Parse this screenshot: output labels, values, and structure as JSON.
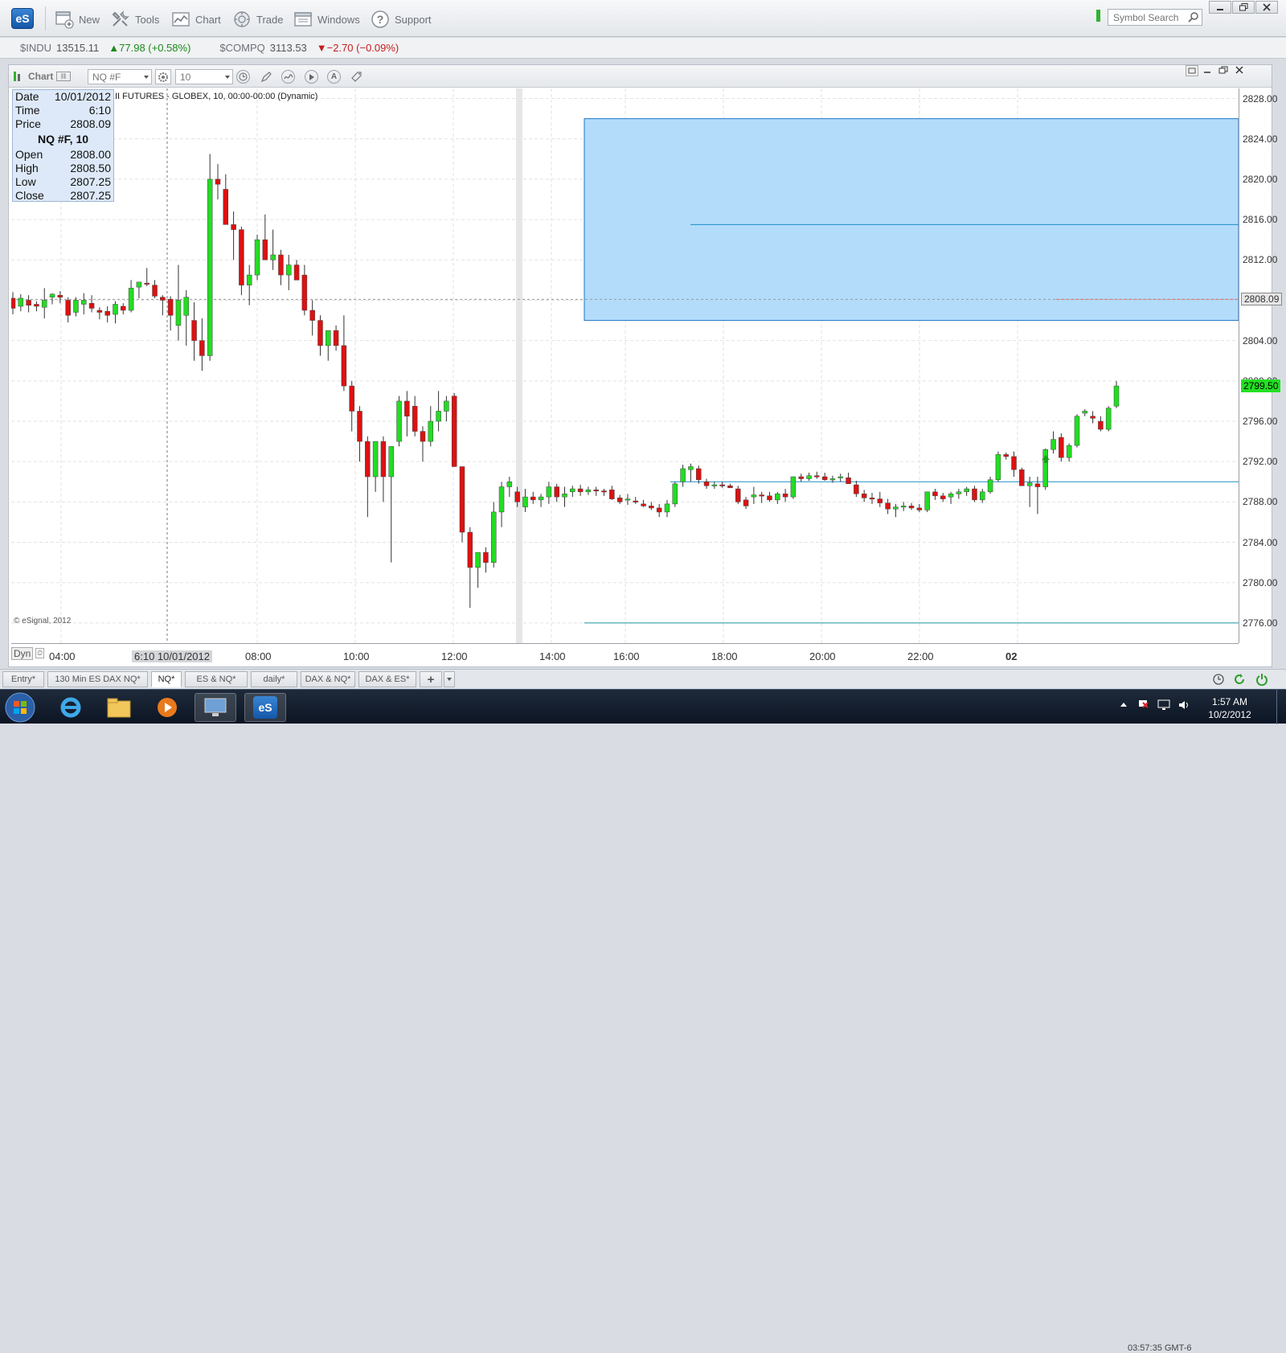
{
  "toolbar": {
    "logo": "eS",
    "buttons": [
      {
        "label": "New"
      },
      {
        "label": "Tools"
      },
      {
        "label": "Chart"
      },
      {
        "label": "Trade"
      },
      {
        "label": "Windows"
      },
      {
        "label": "Support"
      }
    ],
    "search_placeholder": "Symbol Search"
  },
  "tickers": [
    {
      "symbol": "$INDU",
      "value": "13515.11",
      "change": "▲77.98 (+0.58%)",
      "dir": "up"
    },
    {
      "symbol": "$COMPQ",
      "value": "3113.53",
      "change": "▼−2.70 (−0.09%)",
      "dir": "down"
    }
  ],
  "chart_window": {
    "title": "Chart",
    "symbol": "NQ #F",
    "interval": "10",
    "series_title": "II FUTURES - GLOBEX, 10, 00:00-00:00 (Dynamic)",
    "copyright": "© eSignal, 2012",
    "dyn_label": "Dyn"
  },
  "data_box": {
    "date_label": "Date",
    "date": "10/01/2012",
    "time_label": "Time",
    "time": "6:10",
    "price_label": "Price",
    "price": "2808.09",
    "header": "NQ #F, 10",
    "open_label": "Open",
    "open": "2808.00",
    "high_label": "High",
    "high": "2808.50",
    "low_label": "Low",
    "low": "2807.25",
    "close_label": "Close",
    "close": "2807.25"
  },
  "price_axis": {
    "labels": [
      "2828.00",
      "2824.00",
      "2820.00",
      "2816.00",
      "2812.00",
      "2808.09",
      "2804.00",
      "2800.00",
      "2796.00",
      "2792.00",
      "2788.00",
      "2784.00",
      "2780.00",
      "2776.00"
    ],
    "current_price": "2799.50",
    "cursor_price": "2808.09"
  },
  "time_axis": {
    "cursor_label": "6:10 10/01/2012",
    "labels": [
      "04:00",
      "08:00",
      "10:00",
      "12:00",
      "14:00",
      "16:00",
      "18:00",
      "20:00",
      "22:00",
      "02"
    ]
  },
  "tabs": [
    {
      "label": "Entry*"
    },
    {
      "label": "130 Min ES DAX NQ*"
    },
    {
      "label": "NQ*"
    },
    {
      "label": "ES & NQ*"
    },
    {
      "label": "daily*"
    },
    {
      "label": "DAX & NQ*"
    },
    {
      "label": "DAX & ES*"
    },
    {
      "label": "+"
    }
  ],
  "status": {
    "clock": "03:57:35 GMT-6"
  },
  "taskbar": {
    "time": "1:57 AM",
    "date": "10/2/2012"
  },
  "colors": {
    "up": "#22dd22",
    "down": "#dd1111",
    "zone": "#b3dcfb",
    "zone_border": "#1f78c8",
    "level_line": "#1a8fc9"
  },
  "chart_data": {
    "type": "candlestick",
    "symbol": "NQ #F",
    "interval_minutes": 10,
    "ylim": [
      2774,
      2829
    ],
    "y_ticks": [
      2776,
      2780,
      2784,
      2788,
      2792,
      2796,
      2800,
      2804,
      2808,
      2812,
      2816,
      2820,
      2824,
      2828
    ],
    "x_ticks": [
      "04:00",
      "08:00",
      "10:00",
      "12:00",
      "14:00",
      "16:00",
      "18:00",
      "20:00",
      "22:00",
      "02"
    ],
    "candles": [
      [
        2808.2,
        2808.8,
        2806.6,
        2807.2
      ],
      [
        2807.4,
        2808.6,
        2806.9,
        2808.2
      ],
      [
        2808.0,
        2808.5,
        2806.8,
        2807.5
      ],
      [
        2807.6,
        2807.9,
        2806.9,
        2807.4
      ],
      [
        2807.3,
        2809.2,
        2806.2,
        2808.0
      ],
      [
        2808.3,
        2808.7,
        2807.6,
        2808.6
      ],
      [
        2808.5,
        2808.9,
        2807.7,
        2808.3
      ],
      [
        2808.0,
        2808.3,
        2805.8,
        2806.5
      ],
      [
        2806.8,
        2808.3,
        2806.4,
        2808.0
      ],
      [
        2807.6,
        2808.7,
        2806.6,
        2808.0
      ],
      [
        2807.7,
        2808.5,
        2806.8,
        2807.2
      ],
      [
        2807.0,
        2807.3,
        2806.1,
        2806.8
      ],
      [
        2806.9,
        2807.4,
        2805.8,
        2806.5
      ],
      [
        2806.6,
        2807.9,
        2805.7,
        2807.6
      ],
      [
        2807.4,
        2807.7,
        2806.6,
        2807.0
      ],
      [
        2807.0,
        2810.0,
        2806.8,
        2809.2
      ],
      [
        2809.3,
        2809.8,
        2808.2,
        2809.8
      ],
      [
        2809.7,
        2811.2,
        2809.4,
        2809.6
      ],
      [
        2809.5,
        2810.0,
        2808.2,
        2808.4
      ],
      [
        2808.3,
        2808.5,
        2806.5,
        2808.0
      ],
      [
        2808.1,
        2808.4,
        2805.0,
        2806.5
      ],
      [
        2805.5,
        2811.5,
        2804.0,
        2808.0
      ],
      [
        2806.5,
        2809.0,
        2803.5,
        2808.3
      ],
      [
        2806.0,
        2807.8,
        2802.0,
        2804.0
      ],
      [
        2804.0,
        2806.2,
        2801.0,
        2802.5
      ],
      [
        2802.5,
        2822.5,
        2802.0,
        2820.0
      ],
      [
        2820.0,
        2821.5,
        2818.0,
        2819.5
      ],
      [
        2819.0,
        2820.5,
        2815.5,
        2815.5
      ],
      [
        2815.5,
        2816.8,
        2812.0,
        2815.0
      ],
      [
        2815.0,
        2815.3,
        2808.5,
        2809.5
      ],
      [
        2809.5,
        2811.5,
        2807.5,
        2810.5
      ],
      [
        2810.5,
        2814.5,
        2810.0,
        2814.0
      ],
      [
        2814.0,
        2816.5,
        2812.0,
        2812.0
      ],
      [
        2812.0,
        2815.0,
        2811.0,
        2812.5
      ],
      [
        2812.5,
        2813.0,
        2809.5,
        2810.5
      ],
      [
        2810.5,
        2812.5,
        2809.0,
        2811.5
      ],
      [
        2811.5,
        2812.0,
        2810.0,
        2810.0
      ],
      [
        2810.5,
        2811.5,
        2806.5,
        2807.0
      ],
      [
        2807.0,
        2808.0,
        2804.5,
        2806.0
      ],
      [
        2806.0,
        2806.5,
        2802.5,
        2803.5
      ],
      [
        2803.5,
        2805.0,
        2802.0,
        2805.0
      ],
      [
        2805.0,
        2805.5,
        2803.0,
        2803.5
      ],
      [
        2803.5,
        2806.5,
        2799.0,
        2799.5
      ],
      [
        2799.5,
        2800.0,
        2795.0,
        2797.0
      ],
      [
        2797.0,
        2797.5,
        2792.0,
        2794.0
      ],
      [
        2794.0,
        2794.5,
        2786.5,
        2790.5
      ],
      [
        2790.5,
        2794.0,
        2789.0,
        2794.0
      ],
      [
        2794.0,
        2794.5,
        2788.0,
        2790.5
      ],
      [
        2790.5,
        2793.5,
        2782.0,
        2793.5
      ],
      [
        2794.0,
        2798.5,
        2793.5,
        2798.0
      ],
      [
        2798.0,
        2799.0,
        2794.5,
        2796.5
      ],
      [
        2797.5,
        2798.5,
        2794.5,
        2795.0
      ],
      [
        2795.0,
        2795.5,
        2792.0,
        2794.0
      ],
      [
        2794.0,
        2797.5,
        2793.5,
        2796.0
      ],
      [
        2796.0,
        2799.0,
        2795.0,
        2797.0
      ],
      [
        2797.0,
        2798.5,
        2796.0,
        2798.0
      ],
      [
        2798.5,
        2798.8,
        2791.5,
        2791.5
      ],
      [
        2791.5,
        2791.5,
        2784.0,
        2785.0
      ],
      [
        2785.0,
        2785.5,
        2777.5,
        2781.5
      ],
      [
        2781.5,
        2782.0,
        2779.5,
        2783.0
      ],
      [
        2783.0,
        2783.5,
        2781.0,
        2782.0
      ],
      [
        2782.0,
        2788.0,
        2781.5,
        2787.0
      ],
      [
        2787.0,
        2790.0,
        2785.5,
        2789.5
      ],
      [
        2789.5,
        2790.5,
        2788.5,
        2790.0
      ],
      [
        2789.0,
        2789.5,
        2787.5,
        2788.0
      ],
      [
        2787.5,
        2789.3,
        2787.0,
        2788.5
      ],
      [
        2788.5,
        2789.0,
        2787.8,
        2788.2
      ],
      [
        2788.2,
        2788.8,
        2787.5,
        2788.5
      ],
      [
        2788.5,
        2790.0,
        2787.8,
        2789.5
      ],
      [
        2789.5,
        2789.8,
        2788.0,
        2788.5
      ],
      [
        2788.5,
        2789.5,
        2787.5,
        2788.8
      ],
      [
        2789.0,
        2789.6,
        2788.5,
        2789.3
      ],
      [
        2789.3,
        2789.7,
        2788.6,
        2789.0
      ],
      [
        2789.0,
        2789.5,
        2788.7,
        2789.2
      ],
      [
        2789.2,
        2789.5,
        2788.6,
        2789.1
      ],
      [
        2789.1,
        2789.3,
        2788.6,
        2789.0
      ],
      [
        2789.2,
        2789.6,
        2788.2,
        2788.3
      ],
      [
        2788.4,
        2788.7,
        2787.8,
        2788.0
      ],
      [
        2788.2,
        2788.8,
        2787.7,
        2788.3
      ],
      [
        2788.1,
        2788.5,
        2787.8,
        2788.0
      ],
      [
        2787.8,
        2788.2,
        2787.5,
        2787.6
      ],
      [
        2787.6,
        2788.0,
        2787.2,
        2787.4
      ],
      [
        2787.4,
        2787.8,
        2786.5,
        2787.0
      ],
      [
        2787.0,
        2788.2,
        2786.5,
        2787.8
      ],
      [
        2787.8,
        2790.0,
        2787.5,
        2789.8
      ],
      [
        2790.0,
        2791.7,
        2789.5,
        2791.3
      ],
      [
        2791.2,
        2791.8,
        2790.0,
        2791.5
      ],
      [
        2791.3,
        2791.6,
        2789.8,
        2790.2
      ],
      [
        2790.0,
        2790.3,
        2789.3,
        2789.6
      ],
      [
        2789.6,
        2790.0,
        2789.3,
        2789.7
      ],
      [
        2789.7,
        2790.0,
        2789.4,
        2789.6
      ],
      [
        2789.6,
        2789.8,
        2789.4,
        2789.4
      ],
      [
        2789.3,
        2789.6,
        2787.8,
        2788.0
      ],
      [
        2788.2,
        2788.5,
        2787.3,
        2787.6
      ],
      [
        2788.5,
        2789.5,
        2787.8,
        2788.7
      ],
      [
        2788.7,
        2789.0,
        2787.9,
        2788.6
      ],
      [
        2788.6,
        2789.0,
        2788.0,
        2788.2
      ],
      [
        2788.2,
        2789.0,
        2787.8,
        2788.8
      ],
      [
        2788.8,
        2789.3,
        2788.0,
        2788.5
      ],
      [
        2788.5,
        2790.5,
        2788.3,
        2790.5
      ],
      [
        2790.5,
        2790.8,
        2790.0,
        2790.3
      ],
      [
        2790.3,
        2790.9,
        2790.1,
        2790.6
      ],
      [
        2790.6,
        2791.0,
        2790.3,
        2790.5
      ],
      [
        2790.5,
        2790.9,
        2790.1,
        2790.2
      ],
      [
        2790.2,
        2790.6,
        2789.9,
        2790.3
      ],
      [
        2790.5,
        2790.8,
        2790.0,
        2790.5
      ],
      [
        2790.4,
        2790.9,
        2789.8,
        2789.8
      ],
      [
        2789.7,
        2790.1,
        2788.5,
        2788.8
      ],
      [
        2788.8,
        2789.2,
        2788.0,
        2788.4
      ],
      [
        2788.4,
        2788.9,
        2787.8,
        2788.3
      ],
      [
        2788.3,
        2789.0,
        2787.5,
        2787.9
      ],
      [
        2787.9,
        2788.3,
        2786.8,
        2787.3
      ],
      [
        2787.3,
        2787.8,
        2786.5,
        2787.5
      ],
      [
        2787.5,
        2788.0,
        2787.1,
        2787.6
      ],
      [
        2787.6,
        2787.9,
        2787.2,
        2787.4
      ],
      [
        2787.4,
        2787.8,
        2787.0,
        2787.2
      ],
      [
        2787.2,
        2789.0,
        2787.0,
        2789.0
      ],
      [
        2789.0,
        2789.3,
        2788.2,
        2788.6
      ],
      [
        2788.6,
        2788.9,
        2788.0,
        2788.3
      ],
      [
        2788.5,
        2789.0,
        2787.8,
        2788.8
      ],
      [
        2788.8,
        2789.3,
        2788.3,
        2789.0
      ],
      [
        2789.0,
        2789.5,
        2788.6,
        2789.3
      ],
      [
        2789.3,
        2789.6,
        2788.0,
        2788.2
      ],
      [
        2788.2,
        2789.3,
        2787.9,
        2789.0
      ],
      [
        2789.0,
        2790.5,
        2788.8,
        2790.2
      ],
      [
        2790.2,
        2793.0,
        2790.0,
        2792.7
      ],
      [
        2792.7,
        2792.9,
        2792.2,
        2792.5
      ],
      [
        2792.5,
        2793.0,
        2790.5,
        2791.2
      ],
      [
        2791.2,
        2791.4,
        2789.6,
        2789.6
      ],
      [
        2789.6,
        2790.5,
        2787.5,
        2789.9
      ],
      [
        2789.8,
        2790.5,
        2786.8,
        2789.5
      ],
      [
        2789.5,
        2793.3,
        2789.2,
        2793.2
      ],
      [
        2793.2,
        2795.0,
        2792.8,
        2794.2
      ],
      [
        2794.4,
        2794.8,
        2792.0,
        2792.4
      ],
      [
        2792.4,
        2793.8,
        2792.0,
        2793.6
      ],
      [
        2793.6,
        2796.7,
        2793.4,
        2796.5
      ],
      [
        2796.8,
        2797.2,
        2796.5,
        2797.0
      ],
      [
        2796.5,
        2797.0,
        2795.8,
        2796.3
      ],
      [
        2796.0,
        2796.5,
        2795.0,
        2795.2
      ],
      [
        2795.2,
        2797.5,
        2795.0,
        2797.3
      ],
      [
        2797.5,
        2800.0,
        2797.3,
        2799.5
      ]
    ],
    "levels": [
      2815.5,
      2790.0,
      2776.0
    ],
    "zone": [
      2806.0,
      2826.0
    ],
    "crosshair_price": 2808.09
  }
}
